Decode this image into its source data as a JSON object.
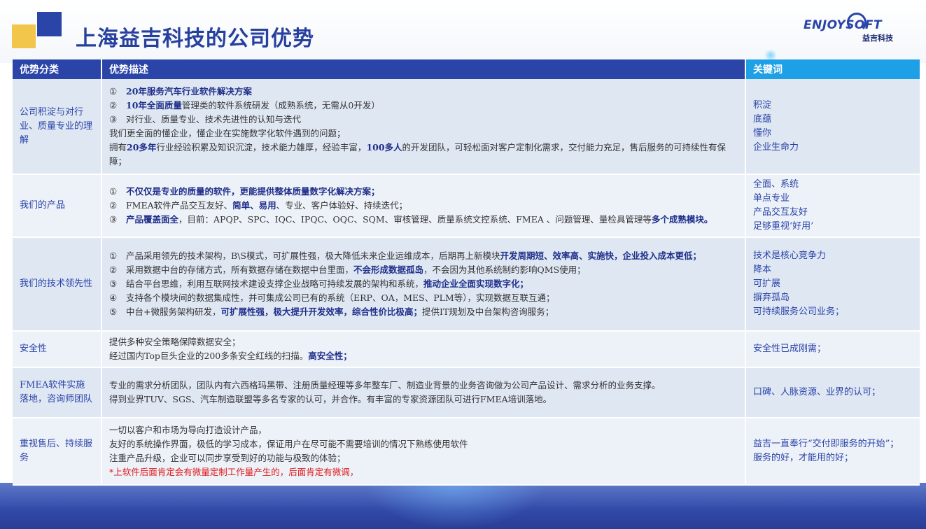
{
  "header": {
    "title": "上海益吉科技的公司优势",
    "logo_text": "ENJOYSOFT",
    "logo_sub": "益吉科技"
  },
  "colors": {
    "header_blue": "#2a44a8",
    "header_cyan": "#1ea0e6",
    "accent_yellow": "#f2c64a",
    "row_bg": "#dfe7f3",
    "alert_red": "#e01b1b"
  },
  "table": {
    "columns": [
      "优势分类",
      "优势描述",
      "关键词"
    ],
    "rows": [
      {
        "category": "公司积淀与对行业、质量专业的理解",
        "description": [
          [
            {
              "t": "①",
              "m": 1
            },
            {
              "t": "20年服务汽车行业软件解决方案",
              "b": 1
            }
          ],
          [
            {
              "t": "②",
              "m": 1
            },
            {
              "t": "10年全面质量",
              "b": 1
            },
            {
              "t": "管理类的软件系统研发（成熟系统，无需从0开发）"
            }
          ],
          [
            {
              "t": "③",
              "m": 1
            },
            {
              "t": "对行业、质量专业、技术先进性的认知与迭代"
            }
          ],
          [
            {
              "t": "我们更全面的懂企业，懂企业在实施数字化软件遇到的问题；"
            }
          ],
          [
            {
              "t": "拥有"
            },
            {
              "t": "20多年",
              "b": 1
            },
            {
              "t": "行业经验积累及知识沉淀，技术能力雄厚，经验丰富，"
            },
            {
              "t": "100多人",
              "b": 1
            },
            {
              "t": "的开发团队，可轻松面对客户定制化需求，交付能力充足，售后服务的可持续性有保障；"
            }
          ]
        ],
        "keywords": [
          "积淀",
          "底蕴",
          "懂你",
          "企业生命力"
        ]
      },
      {
        "category": "我们的产品",
        "description": [
          [
            {
              "t": "①",
              "m": 1
            },
            {
              "t": "不仅仅是专业的质量的软件，更能提供整体质量数字化解决方案；",
              "b": 1
            }
          ],
          [
            {
              "t": "②",
              "m": 1
            },
            {
              "t": "FMEA软件产品交互友好、"
            },
            {
              "t": "简单、易用",
              "b": 1
            },
            {
              "t": "、专业、客户体验好、持续迭代；"
            }
          ],
          [
            {
              "t": "③",
              "m": 1
            },
            {
              "t": "产品覆盖面全",
              "b": 1
            },
            {
              "t": "，目前：APQP、SPC、IQC、IPQC、OQC、SQM、审核管理、质量系统文控系统、FMEA 、问题管理、量检具管理等"
            },
            {
              "t": "多个成熟模块。",
              "b": 1
            }
          ]
        ],
        "keywords": [
          "全面、系统",
          "单点专业",
          "产品交互友好",
          "足够重视‘好用’"
        ]
      },
      {
        "category": "我们的技术领先性",
        "description": [
          [
            {
              "t": "①",
              "m": 1
            },
            {
              "t": "产品采用领先的技术架构，B\\S模式，可扩展性强，极大降低未来企业运维成本，后期再上新模块"
            },
            {
              "t": "开发周期短、效率高、实施快，企业投入成本更低；",
              "b": 1
            }
          ],
          [
            {
              "t": "②",
              "m": 1
            },
            {
              "t": "采用数据中台的存储方式，所有数据存储在数据中台里面，"
            },
            {
              "t": "不会形成数据孤岛",
              "b": 1
            },
            {
              "t": "，不会因为其他系统制约影响QMS使用；"
            }
          ],
          [
            {
              "t": "③",
              "m": 1
            },
            {
              "t": "结合平台思维，利用互联网技术建设支撑企业战略可持续发展的架构和系统，"
            },
            {
              "t": "推动企业全面实现数字化；",
              "b": 1
            }
          ],
          [
            {
              "t": "④",
              "m": 1
            },
            {
              "t": "支持各个模块间的数据集成性，并可集成公司已有的系统（ERP、OA，MES、PLM等），实现数据互联互通；"
            }
          ],
          [
            {
              "t": "⑤",
              "m": 1
            },
            {
              "t": "中台+微服务架构研发，"
            },
            {
              "t": "可扩展性强，极大提升开发效率，综合性价比极高；",
              "b": 1
            },
            {
              "t": "提供IT规划及中台架构咨询服务；"
            }
          ]
        ],
        "keywords": [
          "技术是核心竞争力",
          "降本",
          "可扩展",
          "摒弃孤岛",
          "可持续服务公司业务；"
        ]
      },
      {
        "category": "安全性",
        "description": [
          [
            {
              "t": "提供多种安全策略保障数据安全；"
            }
          ],
          [
            {
              "t": "经过国内Top巨头企业的200多条安全红线的扫描。"
            },
            {
              "t": "高安全性；",
              "b": 1
            }
          ]
        ],
        "keywords": [
          "安全性已成刚需；"
        ]
      },
      {
        "category": "FMEA软件实施落地，咨询师团队",
        "description": [
          [
            {
              "t": "专业的需求分析团队，团队内有六西格玛黑带、注册质量经理等多年整车厂、制造业背景的业务咨询做为公司产品设计、需求分析的业务支撑。"
            }
          ],
          [
            {
              "t": "得到业界TUV、SGS、汽车制造联盟等多名专家的认可，并合作。有丰富的专家资源团队可进行FMEA培训落地。"
            }
          ]
        ],
        "keywords": [
          "口碑、人脉资源、业界的认可；"
        ]
      },
      {
        "category": "重视售后、持续服务",
        "description": [
          [
            {
              "t": "一切以客户和市场为导向打造设计产品，"
            }
          ],
          [
            {
              "t": "友好的系统操作界面，极低的学习成本，保证用户在尽可能不需要培训的情况下熟练使用软件"
            }
          ],
          [
            {
              "t": "注重产品升级，企业可以同步享受到好的功能与极致的体验；"
            }
          ],
          [
            {
              "t": "*上软件后面肯定会有微量定制工作量产生的，后面肯定有微调，",
              "r": 1
            }
          ]
        ],
        "keywords": [
          "益吉一直奉行“交付即服务的开始”；",
          "服务的好，才能用的好；"
        ]
      }
    ]
  }
}
